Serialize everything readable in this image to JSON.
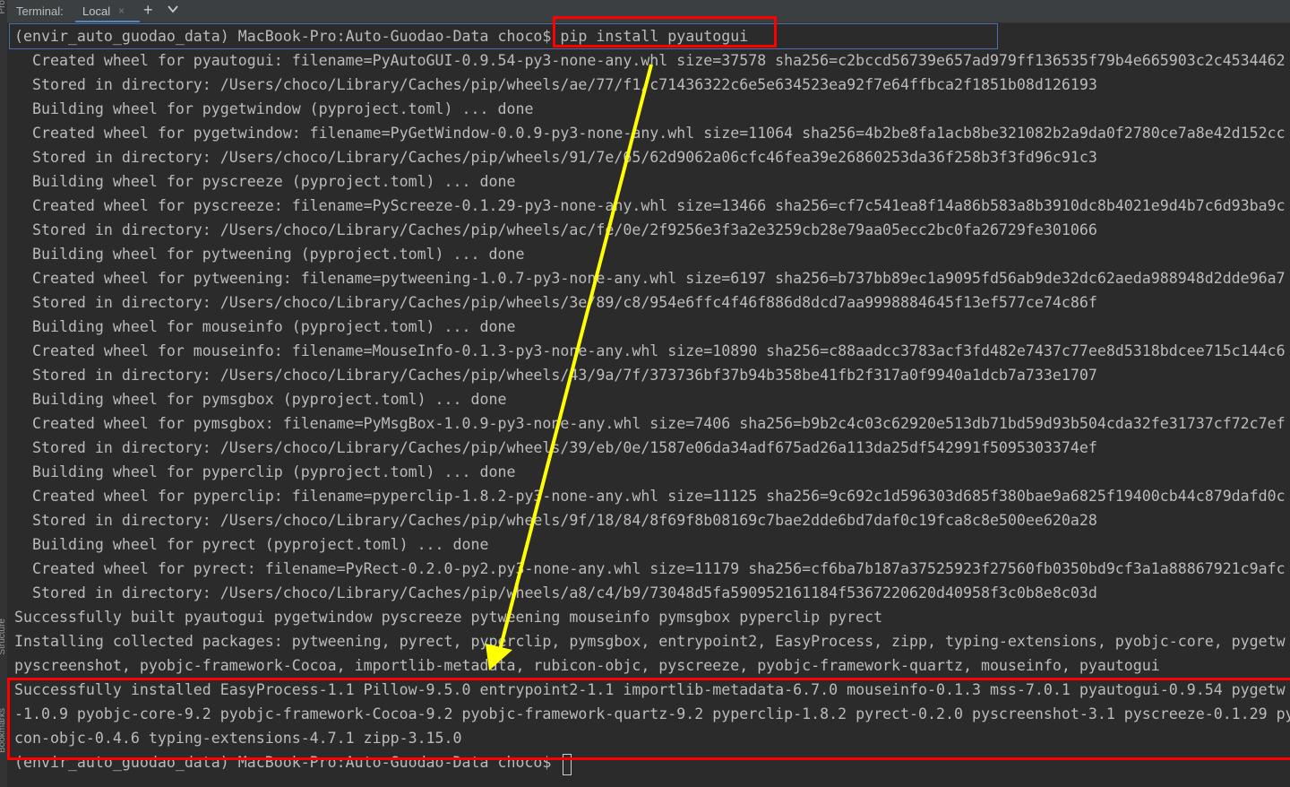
{
  "tabbar": {
    "title": "Terminal:",
    "tab_label": "Local",
    "close_glyph": "×",
    "add_glyph": "+",
    "menu_icon": "chevron-down-icon"
  },
  "sidebar": {
    "top_label": "Pro",
    "structure_label": "Structure",
    "bookmarks_label": "Bookmarks"
  },
  "terminal": {
    "command_prompt": "(envir_auto_guodao_data) MacBook-Pro:Auto-Guodao-Data choco$ ",
    "command": "pip install pyautogui",
    "output_lines": [
      "  Created wheel for pyautogui: filename=PyAutoGUI-0.9.54-py3-none-any.whl size=37578 sha256=c2bccd56739e657ad979ff136535f79b4e665903c2c4534462",
      "  Stored in directory: /Users/choco/Library/Caches/pip/wheels/ae/77/f1/c71436322c6e5e634523ea92f7e64ffbca2f1851b08d126193",
      "  Building wheel for pygetwindow (pyproject.toml) ... done",
      "  Created wheel for pygetwindow: filename=PyGetWindow-0.0.9-py3-none-any.whl size=11064 sha256=4b2be8fa1acb8be321082b2a9da0f2780ce7a8e42d152cc",
      "  Stored in directory: /Users/choco/Library/Caches/pip/wheels/91/7e/65/62d9062a06cfc46fea39e26860253da36f258b3f3fd96c91c3",
      "  Building wheel for pyscreeze (pyproject.toml) ... done",
      "  Created wheel for pyscreeze: filename=PyScreeze-0.1.29-py3-none-any.whl size=13466 sha256=cf7c541ea8f14a86b583a8b3910dc8b4021e9d4b7c6d93ba9c",
      "  Stored in directory: /Users/choco/Library/Caches/pip/wheels/ac/fe/0e/2f9256e3f3a2e3259cb28e79aa05ecc2bc0fa26729fe301066",
      "  Building wheel for pytweening (pyproject.toml) ... done",
      "  Created wheel for pytweening: filename=pytweening-1.0.7-py3-none-any.whl size=6197 sha256=b737bb89ec1a9095fd56ab9de32dc62aeda988948d2dde96a7",
      "  Stored in directory: /Users/choco/Library/Caches/pip/wheels/3e/89/c8/954e6ffc4f46f886d8dcd7aa9998884645f13ef577ce74c86f",
      "  Building wheel for mouseinfo (pyproject.toml) ... done",
      "  Created wheel for mouseinfo: filename=MouseInfo-0.1.3-py3-none-any.whl size=10890 sha256=c88aadcc3783acf3fd482e7437c77ee8d5318bdcee715c144c6",
      "  Stored in directory: /Users/choco/Library/Caches/pip/wheels/43/9a/7f/373736bf37b94b358be41fb2f317a0f9940a1dcb7a733e1707",
      "  Building wheel for pymsgbox (pyproject.toml) ... done",
      "  Created wheel for pymsgbox: filename=PyMsgBox-1.0.9-py3-none-any.whl size=7406 sha256=b9b2c4c03c62920e513db71bd59d93b504cda32fe31737cf72c7ef",
      "  Stored in directory: /Users/choco/Library/Caches/pip/wheels/39/eb/0e/1587e06da34adf675ad26a113da25df542991f5095303374ef",
      "  Building wheel for pyperclip (pyproject.toml) ... done",
      "  Created wheel for pyperclip: filename=pyperclip-1.8.2-py3-none-any.whl size=11125 sha256=9c692c1d596303d685f380bae9a6825f19400cb44c879dafd0c",
      "  Stored in directory: /Users/choco/Library/Caches/pip/wheels/9f/18/84/8f69f8b08169c7bae2dde6bd7daf0c19fca8c8e500ee620a28",
      "  Building wheel for pyrect (pyproject.toml) ... done",
      "  Created wheel for pyrect: filename=PyRect-0.2.0-py2.py3-none-any.whl size=11179 sha256=cf6ba7b187a37525923f27560fb0350bd9cf3a1a88867921c9afc",
      "  Stored in directory: /Users/choco/Library/Caches/pip/wheels/a8/c4/b9/73048d5fa590952161184f5367220620d40958f3c0b8e8c03d",
      "Successfully built pyautogui pygetwindow pyscreeze pytweening mouseinfo pymsgbox pyperclip pyrect",
      "Installing collected packages: pytweening, pyrect, pyperclip, pymsgbox, entrypoint2, EasyProcess, zipp, typing-extensions, pyobjc-core, pygetw",
      "pyscreenshot, pyobjc-framework-Cocoa, importlib-metadata, rubicon-objc, pyscreeze, pyobjc-framework-quartz, mouseinfo, pyautogui",
      "Successfully installed EasyProcess-1.1 Pillow-9.5.0 entrypoint2-1.1 importlib-metadata-6.7.0 mouseinfo-0.1.3 mss-7.0.1 pyautogui-0.9.54 pygetw",
      "-1.0.9 pyobjc-core-9.2 pyobjc-framework-Cocoa-9.2 pyobjc-framework-quartz-9.2 pyperclip-1.8.2 pyrect-0.2.0 pyscreenshot-3.1 pyscreeze-0.1.29 py",
      "con-objc-0.4.6 typing-extensions-4.7.1 zipp-3.15.0"
    ],
    "final_prompt": "(envir_auto_guodao_data) MacBook-Pro:Auto-Guodao-Data choco$ "
  },
  "annotations": {
    "box_color": "#ff0000",
    "arrow_color": "#ffff00"
  }
}
